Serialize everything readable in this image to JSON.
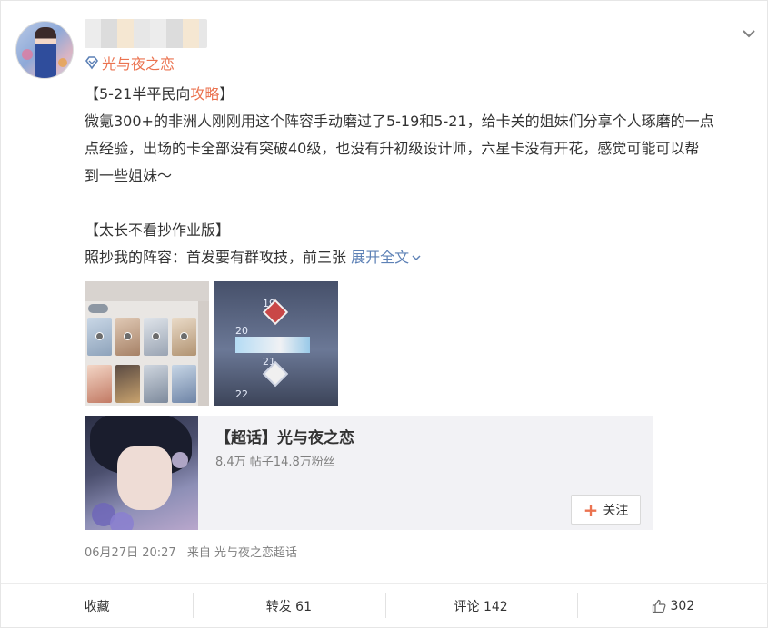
{
  "post": {
    "source": "光与夜之恋",
    "title_prefix": "【5-21半平民向",
    "title_highlight": "攻略",
    "title_suffix": "】",
    "lines": [
      "微氪300+的非洲人刚刚用这个阵容手动磨过了5-19和5-21，给卡关的姐妹们分享个人琢磨的一点",
      "点经验，出场的卡全部没有突破40级，也没有升初级设计师，六星卡没有开花，感觉可能可以帮",
      "到一些姐妹～"
    ],
    "section_title": "【太长不看抄作业版】",
    "preview_line": "照抄我的阵容：首发要有群攻技，前三张",
    "expand_label": "展开全文"
  },
  "images": [
    {
      "name": "team-screenshot"
    },
    {
      "name": "stage-map-screenshot",
      "levels": [
        "19",
        "20",
        "21",
        "22"
      ]
    }
  ],
  "topic": {
    "title": "【超话】光与夜之恋",
    "stats": "8.4万 帖子14.8万粉丝",
    "follow_label": "关注"
  },
  "meta": {
    "time": "06月27日 20:27",
    "from": "来自 光与夜之恋超话"
  },
  "actions": {
    "favorite": "收藏",
    "repost": "转发 61",
    "comment": "评论 142",
    "like": "302"
  },
  "colors": {
    "accent": "#eb7350",
    "link": "#5d81b6",
    "muted": "#808080"
  },
  "icons": [
    "chevron-down-icon",
    "super-topic-icon",
    "plus-icon",
    "like-icon"
  ]
}
